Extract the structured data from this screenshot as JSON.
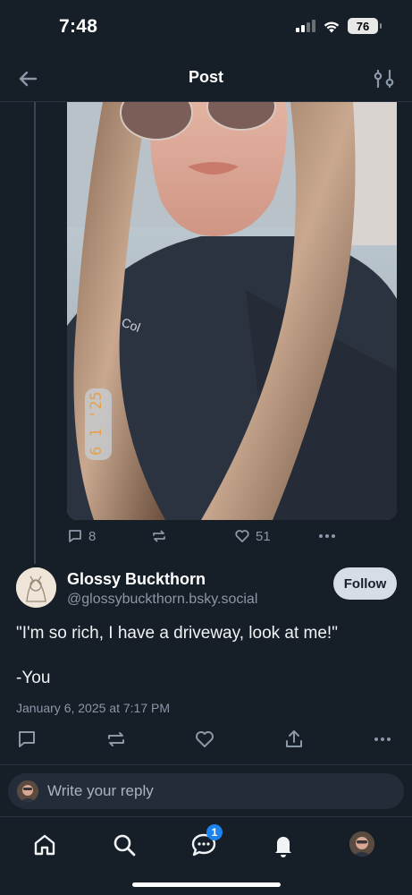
{
  "status_bar": {
    "time": "7:48",
    "battery": "76"
  },
  "header": {
    "title": "Post",
    "back_icon": "arrow-left-icon",
    "filter_icon": "sliders-icon"
  },
  "parent_post": {
    "image_stamp": "6 1 '25",
    "actions": {
      "replies": "8",
      "likes": "51"
    }
  },
  "post": {
    "author_name": "Glossy Buckthorn",
    "author_handle": "@glossybuckthorn.bsky.social",
    "follow_label": "Follow",
    "text_line1": "\"I'm so rich, I have a driveway, look at me!\"",
    "text_line2": "-You",
    "date": "January 6, 2025 at 7:17 PM"
  },
  "reply": {
    "placeholder": "Write your reply"
  },
  "tab_bar": {
    "chat_badge": "1"
  },
  "colors": {
    "background": "#161e27",
    "accent": "#1d84ef",
    "muted": "#8b98a8"
  }
}
